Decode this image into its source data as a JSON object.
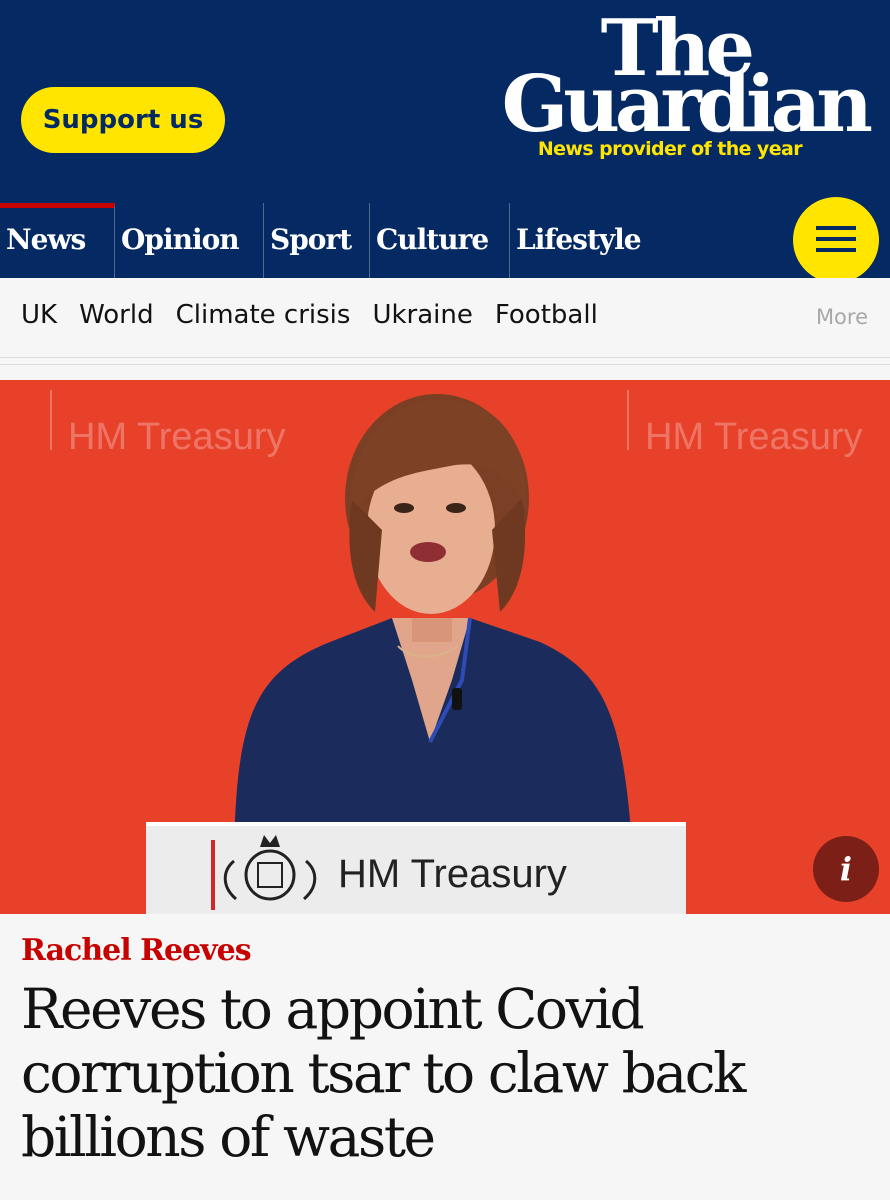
{
  "header": {
    "support_label": "Support us",
    "logo_line1": "The",
    "logo_line2": "Guardian",
    "tagline": "News provider of the year"
  },
  "pillars": [
    {
      "label": "News",
      "active": true
    },
    {
      "label": "Opinion"
    },
    {
      "label": "Sport"
    },
    {
      "label": "Culture"
    },
    {
      "label": "Lifestyle"
    }
  ],
  "menu": {
    "icon": "hamburger-menu-icon"
  },
  "subnav": {
    "items": [
      "UK",
      "World",
      "Climate crisis",
      "Ukraine",
      "Football"
    ],
    "more_label": "More"
  },
  "hero": {
    "backdrop_text": "HM Treasury",
    "podium_text": "HM Treasury",
    "info_label": "i",
    "colors": {
      "backdrop": "#e8412a",
      "jacket": "#1b2c5c"
    }
  },
  "article": {
    "kicker": "Rachel Reeves",
    "headline": "Reeves to appoint Covid corruption tsar to claw back billions of waste"
  },
  "colors": {
    "brand_blue": "#052962",
    "brand_yellow": "#ffe500",
    "news_red": "#c70000"
  }
}
